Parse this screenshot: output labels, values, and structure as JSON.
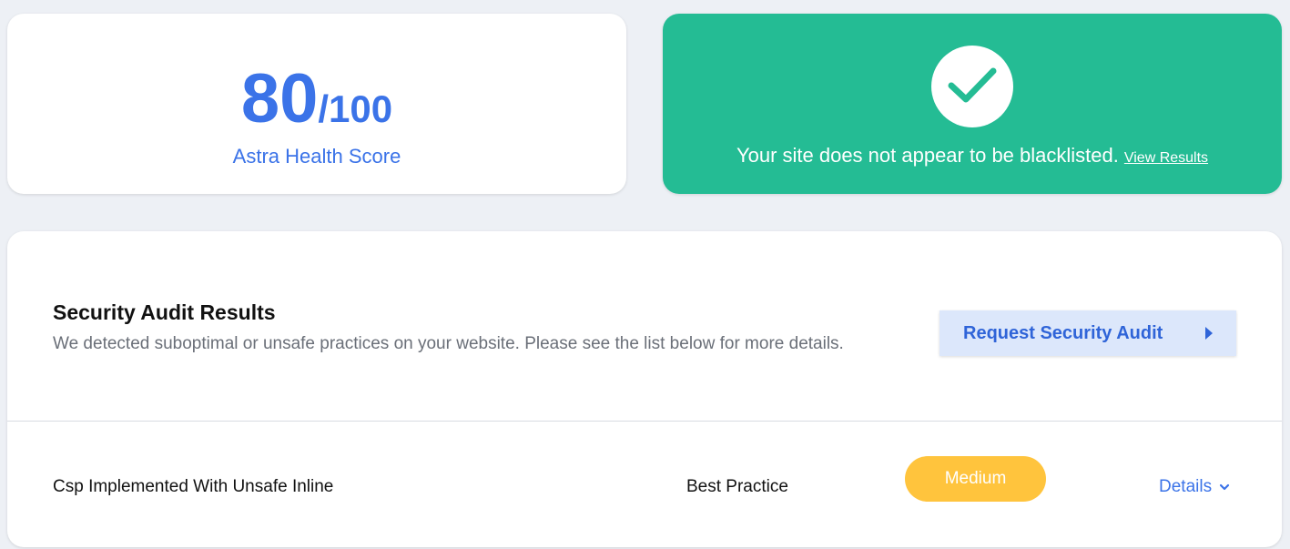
{
  "score_card": {
    "score": "80",
    "max": "/100",
    "label": "Astra Health Score"
  },
  "blacklist_card": {
    "icon": "checkmark-icon",
    "message": "Your site does not appear to be blacklisted.",
    "link_label": "View Results"
  },
  "audit": {
    "title": "Security Audit Results",
    "description": "We detected suboptimal or unsafe practices on your website. Please see the list below for more details.",
    "request_button_label": "Request Security Audit",
    "request_button_icon": "caret-right-icon",
    "issues": [
      {
        "name": "Csp Implemented With Unsafe Inline",
        "type": "Best Practice",
        "severity": "Medium",
        "details_label": "Details",
        "details_icon": "chevron-down-icon"
      }
    ]
  },
  "colors": {
    "background": "#edf0f5",
    "accent_blue": "#3b73e8",
    "success_green": "#24bc94",
    "medium_severity": "#ffc43d",
    "button_bg": "#dce7fb"
  }
}
